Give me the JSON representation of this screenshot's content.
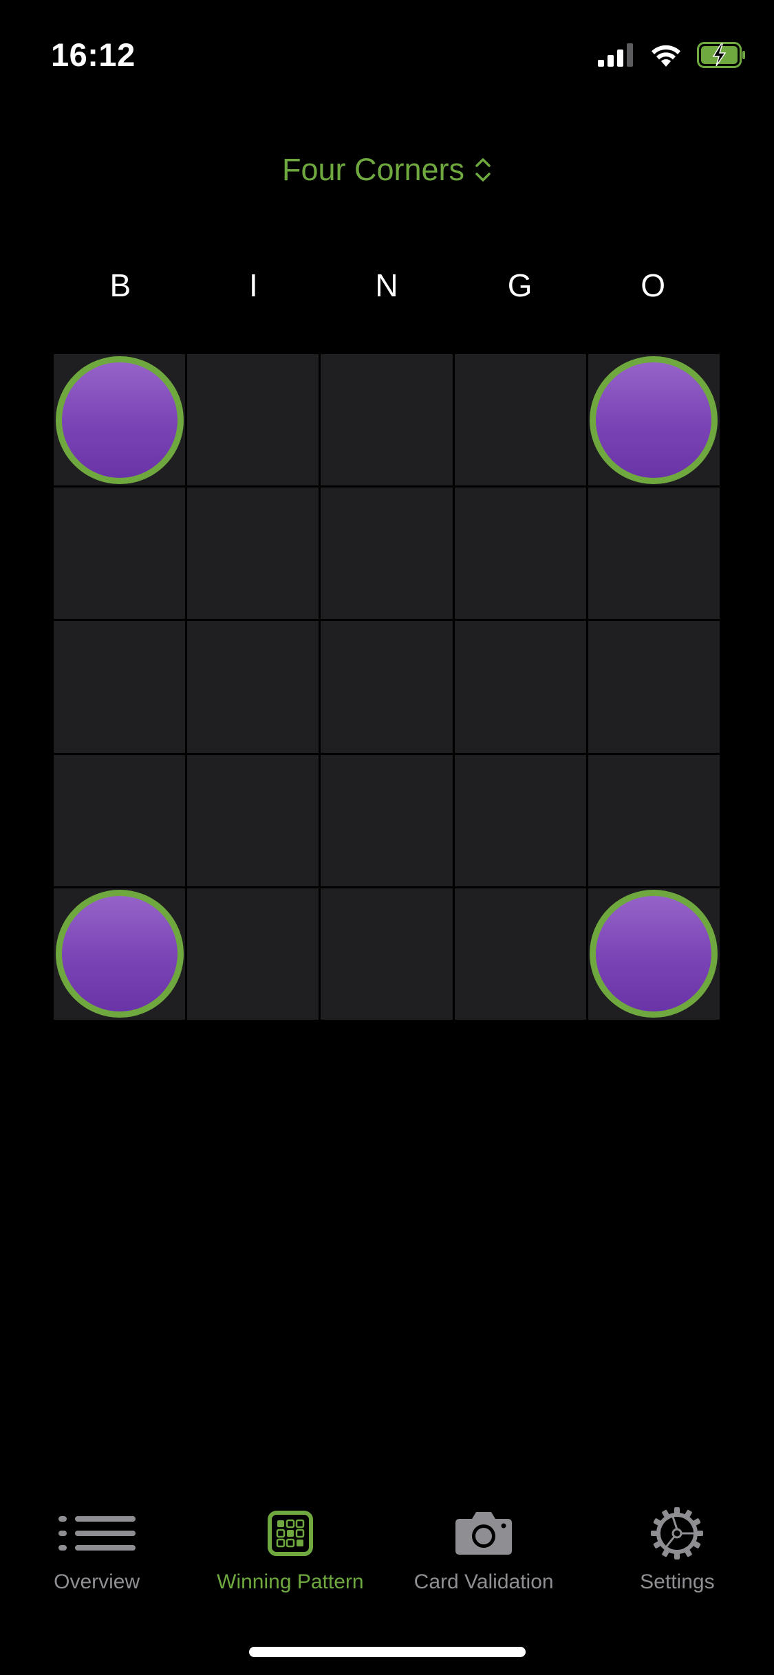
{
  "status_bar": {
    "time": "16:12"
  },
  "pattern_selector": {
    "label": "Four Corners"
  },
  "header": {
    "letters": [
      "B",
      "I",
      "N",
      "G",
      "O"
    ]
  },
  "grid": {
    "rows": [
      [
        true,
        false,
        false,
        false,
        true
      ],
      [
        false,
        false,
        false,
        false,
        false
      ],
      [
        false,
        false,
        false,
        false,
        false
      ],
      [
        false,
        false,
        false,
        false,
        false
      ],
      [
        true,
        false,
        false,
        false,
        true
      ]
    ]
  },
  "tabs": [
    {
      "label": "Overview",
      "icon": "list-icon"
    },
    {
      "label": "Winning Pattern",
      "icon": "pattern-grid-icon",
      "active": true
    },
    {
      "label": "Card Validation",
      "icon": "camera-icon"
    },
    {
      "label": "Settings",
      "icon": "gear-icon"
    }
  ],
  "colors": {
    "accent": "#6fa83f",
    "chip": "#7a43b5",
    "cell": "#1f1f21",
    "inactive": "#8e8e93"
  }
}
